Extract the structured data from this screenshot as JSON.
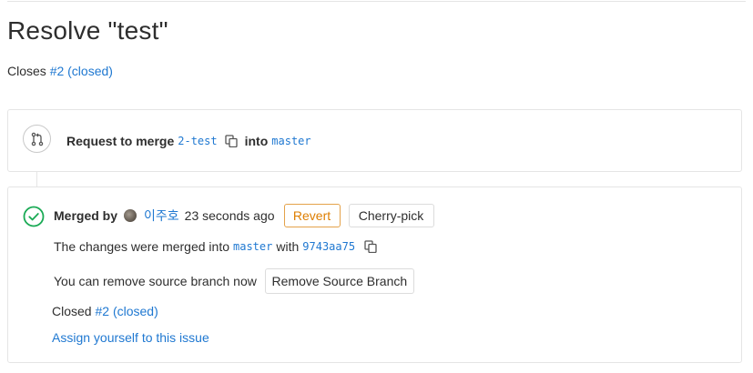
{
  "page": {
    "title": "Resolve \"test\"",
    "description_prefix": "Closes",
    "description_issue": "#2 (closed)"
  },
  "merge_request": {
    "request_label": "Request to merge",
    "source_branch": "2-test",
    "into_label": "into",
    "target_branch": "master"
  },
  "merged": {
    "merged_by_label": "Merged by",
    "user_name": "이주호",
    "time_ago": "23 seconds ago",
    "revert_label": "Revert",
    "cherry_pick_label": "Cherry-pick",
    "changes_prefix": "The changes were merged into",
    "changes_branch": "master",
    "changes_with": "with",
    "commit_sha": "9743aa75",
    "remove_text": "You can remove source branch now",
    "remove_button_label": "Remove Source Branch",
    "closed_prefix": "Closed",
    "closed_issue": "#2 (closed)",
    "assign_label": "Assign yourself to this issue"
  },
  "colors": {
    "link": "#1f78d1",
    "success": "#1aaa55",
    "warning": "#de7e00"
  },
  "icons": {
    "merge": "merge-request-icon",
    "copy": "copy-icon",
    "status": "check-circle-icon"
  }
}
